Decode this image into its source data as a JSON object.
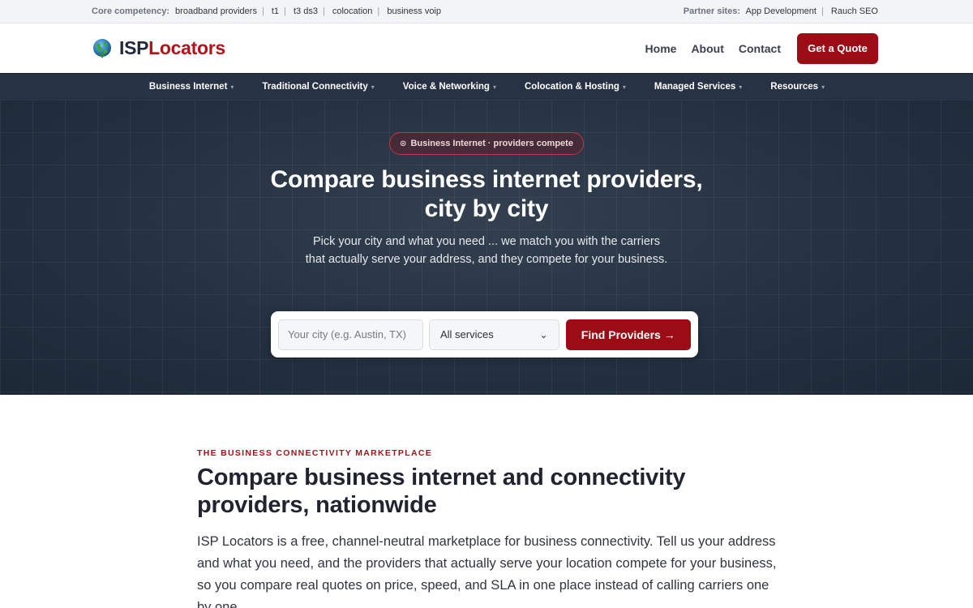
{
  "topbar": {
    "core_label": "Core competency:",
    "core_links": [
      "broadband providers",
      "t1",
      "t3 ds3",
      "colocation",
      "business voip"
    ],
    "partner_label": "Partner sites:",
    "partner_links": [
      "App Development",
      "Rauch SEO"
    ]
  },
  "header": {
    "logo_part1": "ISP",
    "logo_part2": "Locators",
    "nav": [
      "Home",
      "About",
      "Contact"
    ],
    "cta": "Get a Quote"
  },
  "category_nav": [
    "Business Internet",
    "Traditional Connectivity",
    "Voice & Networking",
    "Colocation & Hosting",
    "Managed Services",
    "Resources"
  ],
  "hero": {
    "pill_icon": "⊙",
    "pill": "Business Internet · providers compete",
    "title_line1": "Compare business internet providers,",
    "title_line2": "city by city",
    "sub_line1": "Pick your city and what you need ... we match you with the carriers",
    "sub_line2": "that actually serve your address, and they compete for your business.",
    "search": {
      "city_placeholder": "Your city (e.g. Austin, TX)",
      "service_selected": "All services",
      "button": "Find Providers →"
    }
  },
  "content": {
    "eyebrow": "THE BUSINESS CONNECTIVITY MARKETPLACE",
    "heading": "Compare business internet and connectivity providers, nationwide",
    "paragraph": "ISP Locators is a free, channel-neutral marketplace for business connectivity. Tell us your address and what you need, and the providers that actually serve your location compete for your business, so you compare real quotes on price, speed, and SLA in one place instead of calling carriers one by one."
  },
  "colors": {
    "brand_red": "#9b0c14",
    "nav_dark": "#273344",
    "hero_bg": "#223040"
  }
}
